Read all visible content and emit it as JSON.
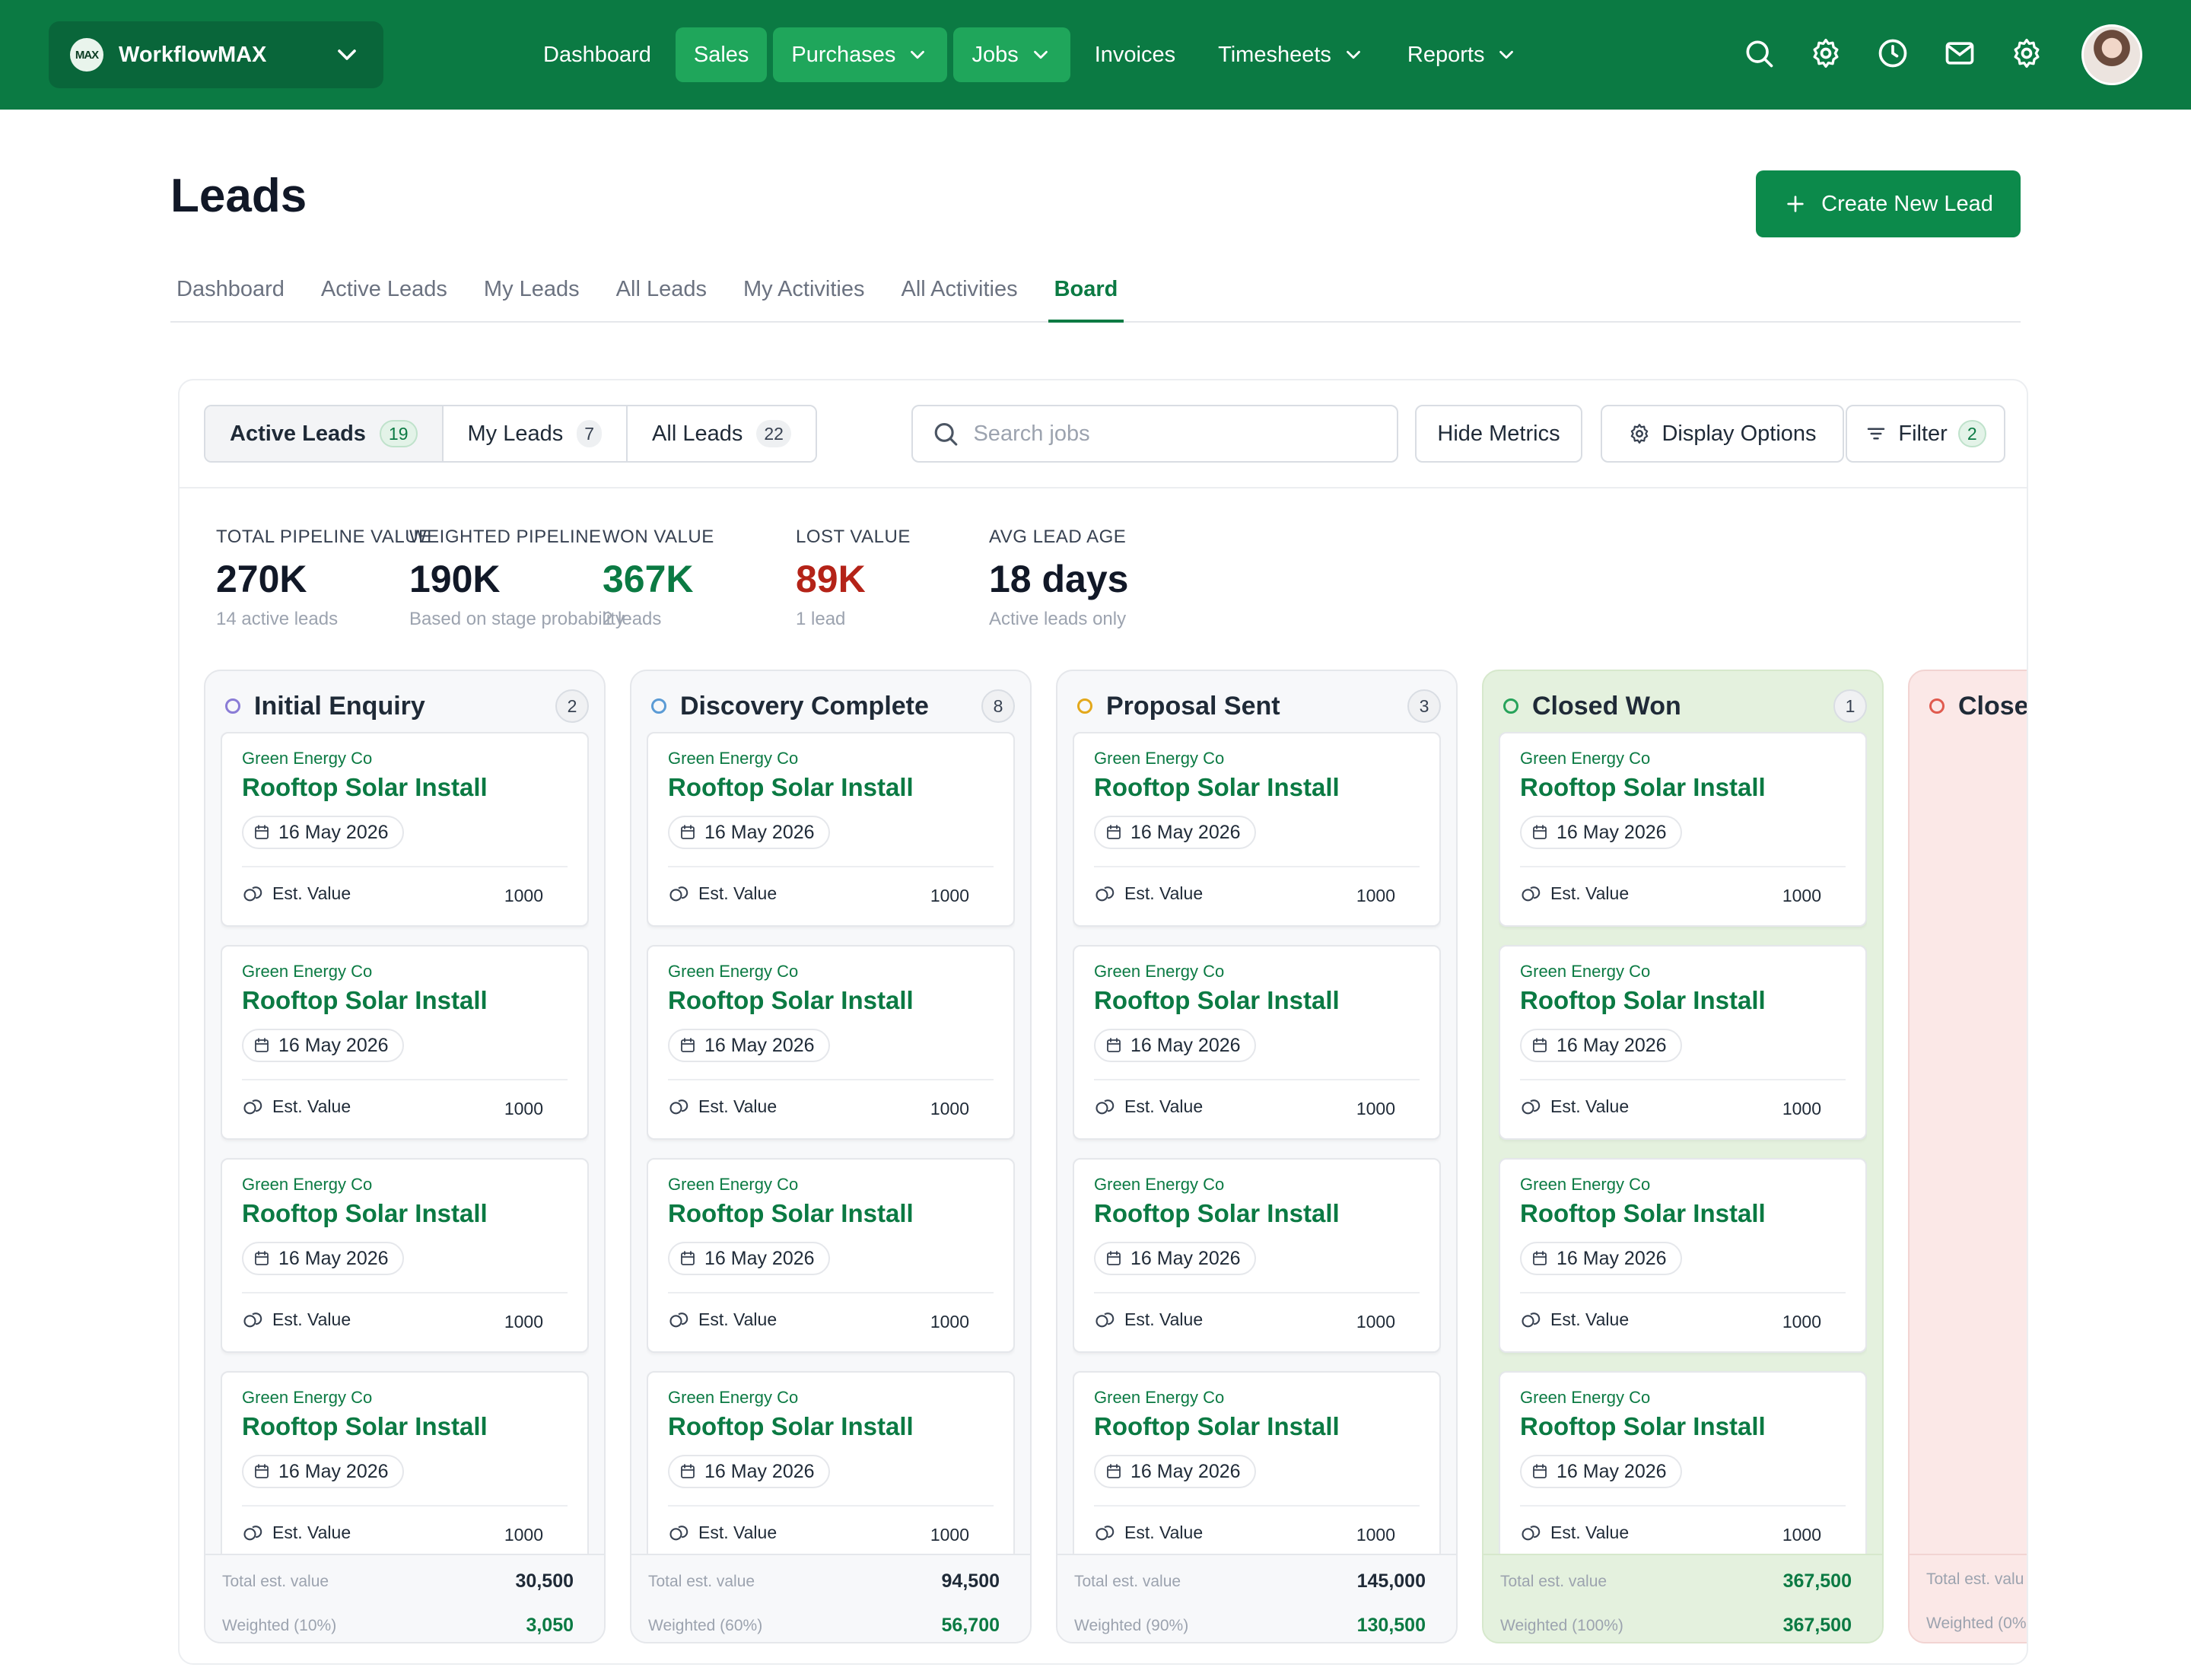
{
  "app": {
    "org_logo_text": "MAX",
    "org_name": "WorkflowMAX",
    "nav": [
      {
        "label": "Dashboard"
      },
      {
        "label": "Sales"
      },
      {
        "label": "Purchases"
      },
      {
        "label": "Jobs"
      },
      {
        "label": "Invoices"
      },
      {
        "label": "Timesheets"
      },
      {
        "label": "Reports"
      }
    ],
    "nav_active": "Sales",
    "nav_icons": [
      "search-icon",
      "settings-icon",
      "clock-icon",
      "mail-icon",
      "gear-icon"
    ],
    "brand_color": "#0b7a43"
  },
  "page": {
    "title": "Leads",
    "create_button": "Create New Lead",
    "tabs": [
      "Dashboard",
      "Active Leads",
      "My Leads",
      "All Leads",
      "My Activities",
      "All Activities",
      "Board"
    ],
    "active_tab": "Board"
  },
  "board": {
    "segments": [
      {
        "label": "Active Leads",
        "count": "19"
      },
      {
        "label": "My Leads",
        "count": "7"
      },
      {
        "label": "All Leads",
        "count": "22"
      }
    ],
    "active_segment": "Active Leads",
    "search_placeholder": "Search jobs",
    "hide_metrics": "Hide Metrics",
    "display_options": "Display Options",
    "filter_label": "Filter",
    "filter_count": "2",
    "metrics": [
      {
        "label": "TOTAL PIPELINE VALUE",
        "value": "270K",
        "sub": "14 active leads",
        "color": "#111827"
      },
      {
        "label": "WEIGHTED PIPELINE",
        "value": "190K",
        "sub": "Based on stage probability",
        "color": "#111827"
      },
      {
        "label": "WON VALUE",
        "value": "367K",
        "sub": "2 leads",
        "color": "#0b7a43"
      },
      {
        "label": "LOST VALUE",
        "value": "89K",
        "sub": "1 lead",
        "color": "#b42318"
      },
      {
        "label": "AVG LEAD AGE",
        "value": "18 days",
        "sub": "Active leads only",
        "color": "#111827"
      }
    ],
    "columns": [
      {
        "title": "Initial Enquiry",
        "count": "2",
        "dot_color": "#8a7cd6",
        "total_label": "Total est. value",
        "total": "30,500",
        "weighted_label": "Weighted (10%)",
        "weighted": "3,050"
      },
      {
        "title": "Discovery Complete",
        "count": "8",
        "dot_color": "#5b9bd5",
        "total_label": "Total est. value",
        "total": "94,500",
        "weighted_label": "Weighted (60%)",
        "weighted": "56,700"
      },
      {
        "title": "Proposal Sent",
        "count": "3",
        "dot_color": "#e3a81b",
        "total_label": "Total est. value",
        "total": "145,000",
        "weighted_label": "Weighted (90%)",
        "weighted": "130,500"
      },
      {
        "title": "Closed Won",
        "count": "1",
        "dot_color": "#27a35a",
        "total_label": "Total est. value",
        "total": "367,500",
        "weighted_label": "Weighted (100%)",
        "weighted": "367,500"
      },
      {
        "title": "Close",
        "count": "",
        "dot_color": "#e05a4e",
        "total_label": "Total est. valu",
        "total": "",
        "weighted_label": "Weighted (0%",
        "weighted": ""
      }
    ],
    "card": {
      "company": "Green Energy Co",
      "title": "Rooftop Solar Install",
      "date": "16 May 2026",
      "value_label": "Est. Value",
      "value": "1000"
    },
    "cards_per_column": [
      4,
      4,
      4,
      4,
      0
    ]
  }
}
